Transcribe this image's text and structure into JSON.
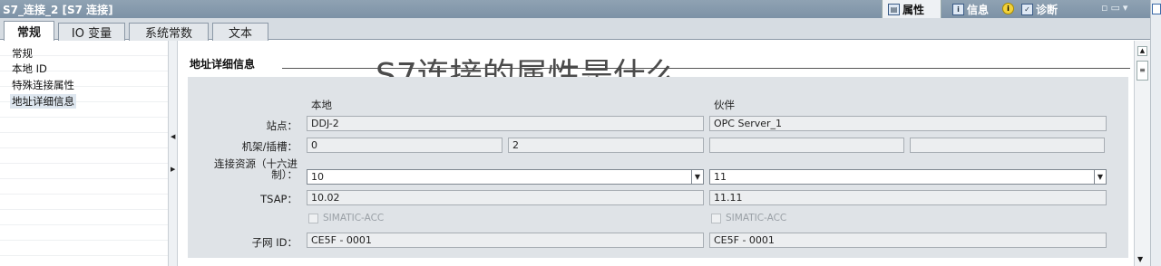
{
  "window": {
    "title": "S7_连接_2 [S7 连接]",
    "inspector_tabs": [
      {
        "label": "属性",
        "icon": "properties-icon"
      },
      {
        "label": "信息",
        "icon": "info-tab-icon"
      },
      {
        "label": "诊断",
        "icon": "diagnostics-icon"
      }
    ]
  },
  "tabs": [
    "常规",
    "IO 变量",
    "系统常数",
    "文本"
  ],
  "nav": {
    "items": [
      "常规",
      "本地 ID",
      "特殊连接属性",
      "地址详细信息"
    ],
    "selected": "地址详细信息"
  },
  "section": {
    "title": "地址详细信息",
    "watermark": "S7连接的属性是什么"
  },
  "form": {
    "col_local": "本地",
    "col_partner": "伙伴",
    "station_label": "站点：",
    "rack_slot_label": "机架/插槽：",
    "conn_res_label_1": "连接资源（十六进",
    "conn_res_label_2": "制）：",
    "tsap_label": "TSAP：",
    "subnet_label": "子网 ID：",
    "local": {
      "station": "DDJ-2",
      "rack": "0",
      "slot": "2",
      "conn_resource": "10",
      "tsap": "10.02",
      "simatic_acc": "SIMATIC-ACC",
      "subnet": "CE5F - 0001"
    },
    "partner": {
      "station": "OPC Server_1",
      "rack": "",
      "slot": "",
      "conn_resource": "11",
      "tsap": "11.11",
      "simatic_acc": "SIMATIC-ACC",
      "subnet": "CE5F - 0001"
    }
  }
}
